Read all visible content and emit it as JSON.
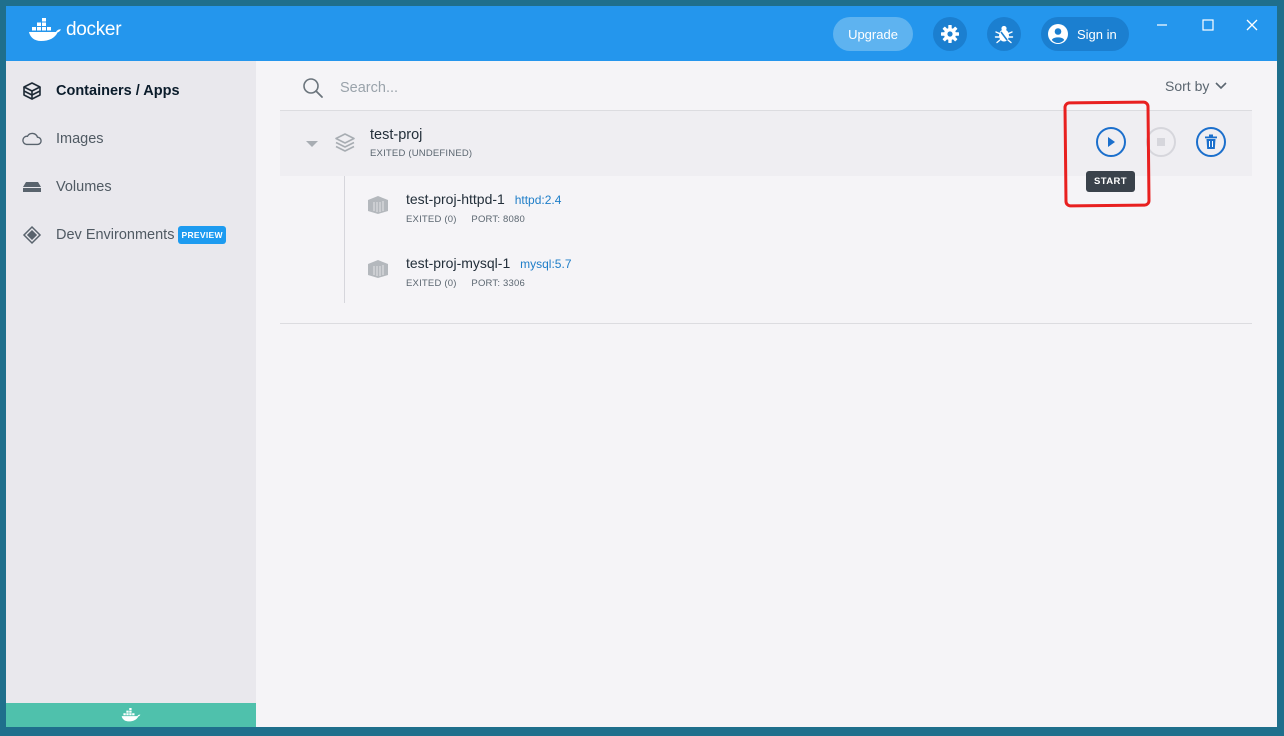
{
  "window": {
    "brand": "docker"
  },
  "header": {
    "upgrade_label": "Upgrade",
    "signin_label": "Sign in",
    "settings_icon": "gear-icon",
    "troubleshoot_icon": "bug-icon",
    "account_icon": "user-icon"
  },
  "sidebar": {
    "items": [
      {
        "label": "Containers / Apps",
        "icon": "cube-icon",
        "active": true
      },
      {
        "label": "Images",
        "icon": "cloud-icon",
        "active": false
      },
      {
        "label": "Volumes",
        "icon": "drive-icon",
        "active": false
      },
      {
        "label": "Dev Environments",
        "icon": "diamond-layers-icon",
        "active": false,
        "badge": "PREVIEW"
      }
    ]
  },
  "main": {
    "search": {
      "placeholder": "Search..."
    },
    "sort_label": "Sort by",
    "app": {
      "name": "test-proj",
      "status": "EXITED (UNDEFINED)",
      "tooltip": "START",
      "containers": [
        {
          "name": "test-proj-httpd-1",
          "image": "httpd:2.4",
          "status": "EXITED (0)",
          "port": "PORT: 8080"
        },
        {
          "name": "test-proj-mysql-1",
          "image": "mysql:5.7",
          "status": "EXITED (0)",
          "port": "PORT: 3306"
        }
      ]
    }
  },
  "colors": {
    "titlebar": "#2496ed",
    "accent": "#1b6fcc",
    "annotation": "#e82020",
    "footer": "#4fc1ac"
  }
}
